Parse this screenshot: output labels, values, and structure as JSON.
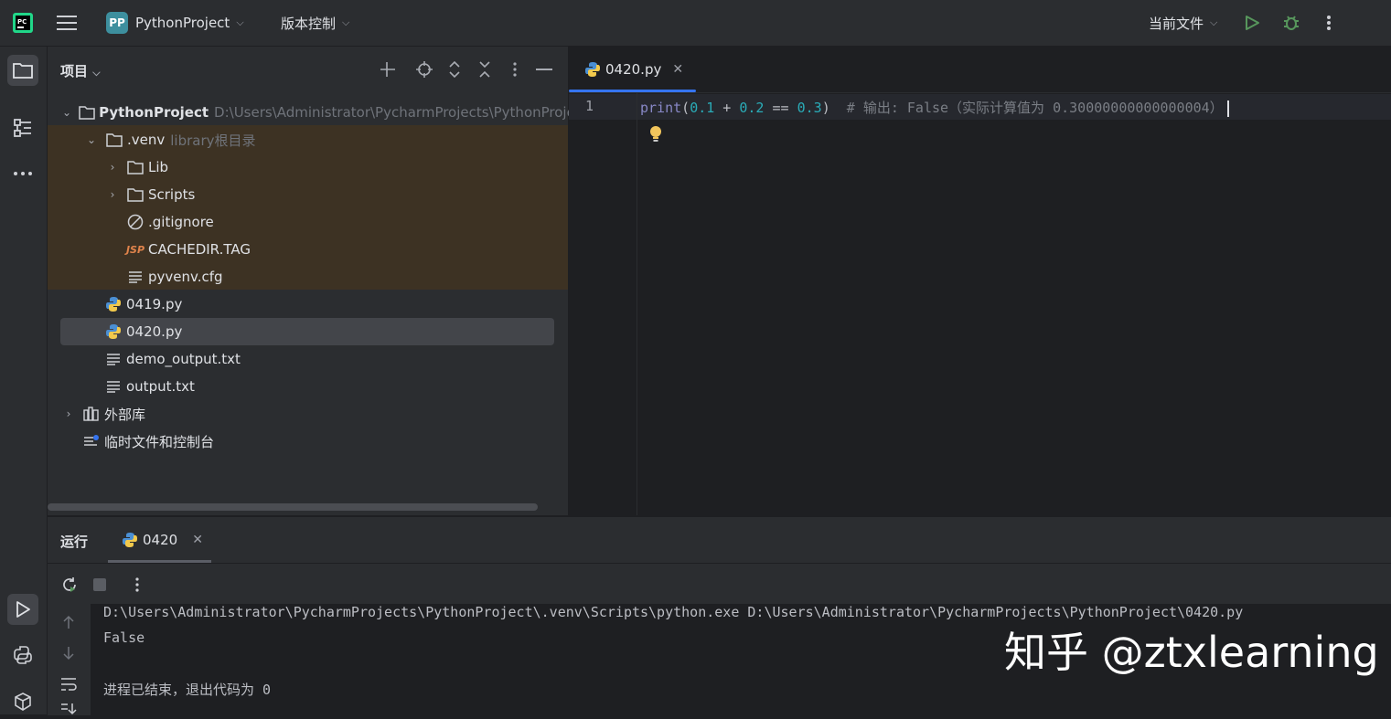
{
  "titlebar": {
    "project_badge": "PP",
    "project_name": "PythonProject",
    "vcs_label": "版本控制",
    "run_config": "当前文件"
  },
  "project_panel": {
    "title": "项目",
    "tree": [
      {
        "label": "PythonProject",
        "hint": "D:\\Users\\Administrator\\PycharmProjects\\PythonProje"
      },
      {
        "label": ".venv",
        "hint": "library根目录"
      },
      {
        "label": "Lib"
      },
      {
        "label": "Scripts"
      },
      {
        "label": ".gitignore"
      },
      {
        "label": "CACHEDIR.TAG",
        "icon_text": "JSP"
      },
      {
        "label": "pyvenv.cfg"
      },
      {
        "label": "0419.py"
      },
      {
        "label": "0420.py"
      },
      {
        "label": "demo_output.txt"
      },
      {
        "label": "output.txt"
      },
      {
        "label": "外部库"
      },
      {
        "label": "临时文件和控制台"
      }
    ]
  },
  "editor": {
    "tab_label": "0420.py",
    "line_number": "1",
    "code": {
      "fn": "print",
      "p1": "(",
      "n1": "0.1",
      "op1": " + ",
      "n2": "0.2",
      "op2": " == ",
      "n3": "0.3",
      "p2": ")",
      "comment": "  # 输出: False（实际计算值为 0.30000000000000004）"
    }
  },
  "run_panel": {
    "title": "运行",
    "tab_label": "0420",
    "console": [
      "D:\\Users\\Administrator\\PycharmProjects\\PythonProject\\.venv\\Scripts\\python.exe D:\\Users\\Administrator\\PycharmProjects\\PythonProject\\0420.py",
      "False",
      "",
      "进程已结束，退出代码为 0"
    ]
  },
  "watermark": "知乎 @ztxlearning",
  "colors": {
    "accent": "#3574f0",
    "run_green": "#57965c",
    "venv_bg": "#3d3223",
    "number": "#2aacb8",
    "builtin": "#8888c6",
    "comment": "#7a7e85"
  }
}
